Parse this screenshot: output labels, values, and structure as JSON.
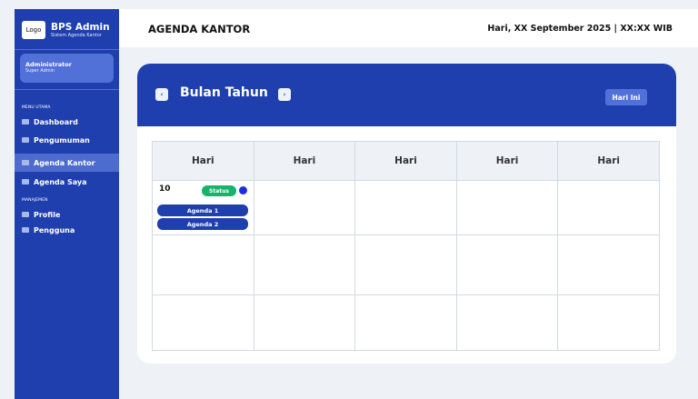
{
  "sidebar": {
    "logo_text": "Logo",
    "brand_title": "BPS Admin",
    "brand_subtitle": "Sistem Agenda Kantor",
    "user_name": "Administrator",
    "user_role": "Super Admin",
    "section_main": "MENU UTAMA",
    "section_manage": "MANAJEMEN",
    "items": [
      {
        "label": "Dashboard",
        "icon": "dashboard-icon"
      },
      {
        "label": "Pengumuman",
        "icon": "announcement-icon"
      },
      {
        "label": "Agenda Kantor",
        "icon": "calendar-icon",
        "active": true
      },
      {
        "label": "Agenda Saya",
        "icon": "calendar-icon"
      },
      {
        "label": "Profile",
        "icon": "profile-icon"
      },
      {
        "label": "Pengguna",
        "icon": "users-icon"
      }
    ]
  },
  "header": {
    "title": "AGENDA KANTOR",
    "datetime": "Hari, XX September 2025 | XX:XX WIB"
  },
  "calendar": {
    "prev_icon": "chevron-left-icon",
    "prev_symbol": "‹",
    "next_icon": "chevron-right-icon",
    "next_symbol": "›",
    "month_title": "Bulan Tahun",
    "today_label": "Hari Ini",
    "day_headers": [
      "Hari",
      "Hari",
      "Hari",
      "Hari",
      "Hari"
    ],
    "first_cell": {
      "day_number": "10",
      "status_label": "Status",
      "status_color": "#16b36a",
      "dot_color": "#1d2ee0",
      "agendas": [
        "Agenda 1",
        "Agenda 2"
      ]
    }
  },
  "colors": {
    "primary": "#1f3fae",
    "accent": "#5170d8",
    "background": "#eef2f7"
  }
}
